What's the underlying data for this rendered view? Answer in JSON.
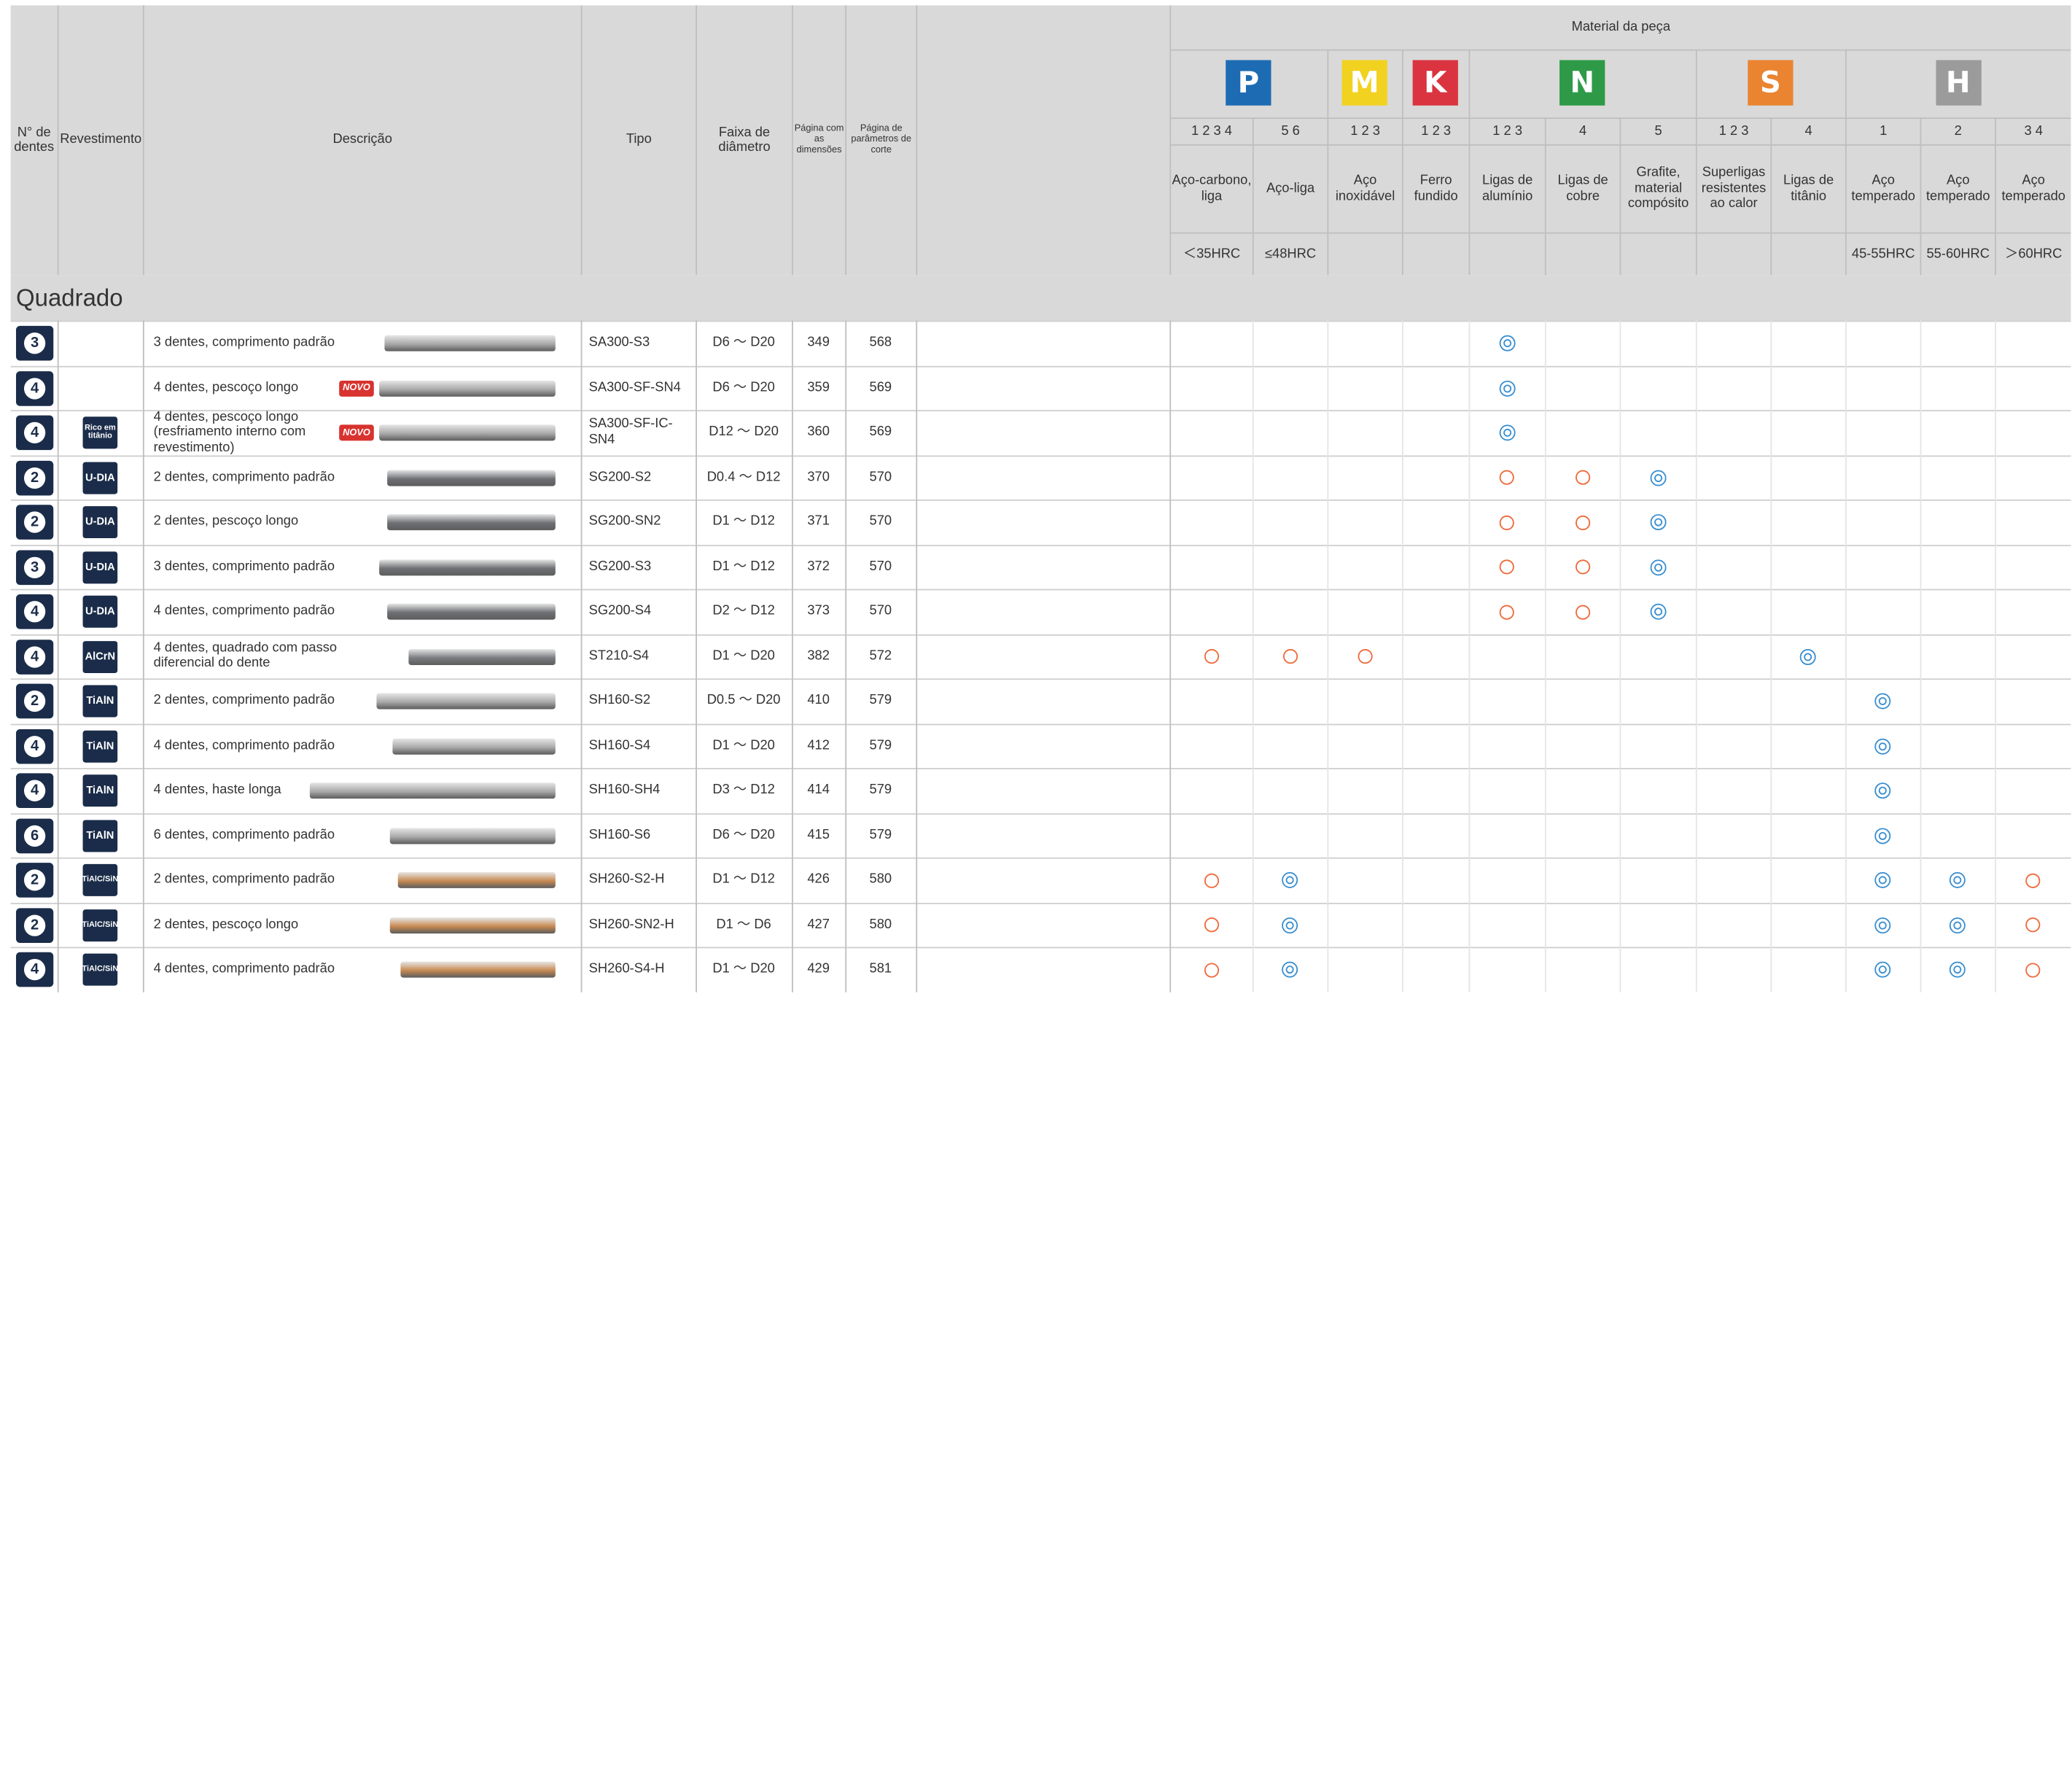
{
  "header": {
    "teeth": "N° de dentes",
    "coating": "Revestimento",
    "description": "Descrição",
    "type": "Tipo",
    "diameter": "Faixa de diâmetro",
    "dim_page": "Página com as dimensões",
    "cut_page": "Página de parâmetros de corte",
    "material_title": "Material da peça"
  },
  "groups": [
    {
      "letter": "P",
      "color": "#1d6bb3"
    },
    {
      "letter": "M",
      "color": "#f2d221"
    },
    {
      "letter": "K",
      "color": "#d9343f"
    },
    {
      "letter": "N",
      "color": "#2e9a48"
    },
    {
      "letter": "S",
      "color": "#ea8431"
    },
    {
      "letter": "H",
      "color": "#9b9b9b"
    }
  ],
  "materials": [
    {
      "num": "1 2 3 4",
      "name": "Aço-carbono, liga",
      "hard": "＜35HRC"
    },
    {
      "num": "5 6",
      "name": "Aço-liga",
      "hard": "≤48HRC"
    },
    {
      "num": "1 2 3",
      "name": "Aço inoxidável",
      "hard": ""
    },
    {
      "num": "1 2 3",
      "name": "Ferro fundido",
      "hard": ""
    },
    {
      "num": "1 2 3",
      "name": "Ligas de alumínio",
      "hard": ""
    },
    {
      "num": "4",
      "name": "Ligas de cobre",
      "hard": ""
    },
    {
      "num": "5",
      "name": "Grafite, material compósito",
      "hard": ""
    },
    {
      "num": "1 2 3",
      "name": "Superligas resistentes ao calor",
      "hard": ""
    },
    {
      "num": "4",
      "name": "Ligas de titânio",
      "hard": ""
    },
    {
      "num": "1",
      "name": "Aço temperado",
      "hard": "45-55HRC"
    },
    {
      "num": "2",
      "name": "Aço temperado",
      "hard": "55-60HRC"
    },
    {
      "num": "3 4",
      "name": "Aço temperado",
      "hard": "＞60HRC"
    }
  ],
  "section_title": "Quadrado",
  "badge_new": "NOVO",
  "rows": [
    {
      "teeth": "3",
      "coating": "",
      "desc": "3 dentes, comprimento padrão",
      "novo": false,
      "type": "SA300-S3",
      "dia": "D6 ～ D20",
      "dim": "349",
      "cut": "568",
      "marks": [
        "",
        "",
        "",
        "",
        "double",
        "",
        "",
        "",
        "",
        "",
        "",
        ""
      ]
    },
    {
      "teeth": "4",
      "coating": "",
      "desc": "4 dentes, pescoço longo",
      "novo": true,
      "type": "SA300-SF-SN4",
      "dia": "D6 ～ D20",
      "dim": "359",
      "cut": "569",
      "marks": [
        "",
        "",
        "",
        "",
        "double",
        "",
        "",
        "",
        "",
        "",
        "",
        ""
      ]
    },
    {
      "teeth": "4",
      "coating": "Rico em titânio",
      "desc": "4 dentes, pescoço longo (resfriamento interno com revestimento)",
      "novo": true,
      "type": "SA300-SF-IC-SN4",
      "dia": "D12 ～ D20",
      "dim": "360",
      "cut": "569",
      "marks": [
        "",
        "",
        "",
        "",
        "double",
        "",
        "",
        "",
        "",
        "",
        "",
        ""
      ]
    },
    {
      "teeth": "2",
      "coating": "U-DIA",
      "desc": "2 dentes, comprimento padrão",
      "novo": false,
      "type": "SG200-S2",
      "dia": "D0.4 ～ D12",
      "dim": "370",
      "cut": "570",
      "marks": [
        "",
        "",
        "",
        "",
        "single",
        "single",
        "double",
        "",
        "",
        "",
        "",
        ""
      ]
    },
    {
      "teeth": "2",
      "coating": "U-DIA",
      "desc": "2 dentes, pescoço longo",
      "novo": false,
      "type": "SG200-SN2",
      "dia": "D1 ～ D12",
      "dim": "371",
      "cut": "570",
      "marks": [
        "",
        "",
        "",
        "",
        "single",
        "single",
        "double",
        "",
        "",
        "",
        "",
        ""
      ]
    },
    {
      "teeth": "3",
      "coating": "U-DIA",
      "desc": "3 dentes, comprimento padrão",
      "novo": false,
      "type": "SG200-S3",
      "dia": "D1 ～ D12",
      "dim": "372",
      "cut": "570",
      "marks": [
        "",
        "",
        "",
        "",
        "single",
        "single",
        "double",
        "",
        "",
        "",
        "",
        ""
      ]
    },
    {
      "teeth": "4",
      "coating": "U-DIA",
      "desc": "4 dentes, comprimento padrão",
      "novo": false,
      "type": "SG200-S4",
      "dia": "D2 ～ D12",
      "dim": "373",
      "cut": "570",
      "marks": [
        "",
        "",
        "",
        "",
        "single",
        "single",
        "double",
        "",
        "",
        "",
        "",
        ""
      ]
    },
    {
      "teeth": "4",
      "coating": "AlCrN",
      "desc": "4 dentes, quadrado com passo diferencial do dente",
      "novo": false,
      "type": "ST210-S4",
      "dia": "D1 ～ D20",
      "dim": "382",
      "cut": "572",
      "marks": [
        "single",
        "single",
        "single",
        "",
        "",
        "",
        "",
        "",
        "double",
        "",
        "",
        ""
      ]
    },
    {
      "teeth": "2",
      "coating": "TiAlN",
      "desc": "2 dentes, comprimento padrão",
      "novo": false,
      "type": "SH160-S2",
      "dia": "D0.5 ～ D20",
      "dim": "410",
      "cut": "579",
      "marks": [
        "",
        "",
        "",
        "",
        "",
        "",
        "",
        "",
        "",
        "double",
        "",
        ""
      ]
    },
    {
      "teeth": "4",
      "coating": "TiAlN",
      "desc": "4 dentes, comprimento padrão",
      "novo": false,
      "type": "SH160-S4",
      "dia": "D1 ～ D20",
      "dim": "412",
      "cut": "579",
      "marks": [
        "",
        "",
        "",
        "",
        "",
        "",
        "",
        "",
        "",
        "double",
        "",
        ""
      ]
    },
    {
      "teeth": "4",
      "coating": "TiAlN",
      "desc": "4 dentes, haste longa",
      "novo": false,
      "type": "SH160-SH4",
      "dia": "D3 ～ D12",
      "dim": "414",
      "cut": "579",
      "marks": [
        "",
        "",
        "",
        "",
        "",
        "",
        "",
        "",
        "",
        "double",
        "",
        ""
      ]
    },
    {
      "teeth": "6",
      "coating": "TiAlN",
      "desc": "6 dentes, comprimento padrão",
      "novo": false,
      "type": "SH160-S6",
      "dia": "D6 ～ D20",
      "dim": "415",
      "cut": "579",
      "marks": [
        "",
        "",
        "",
        "",
        "",
        "",
        "",
        "",
        "",
        "double",
        "",
        ""
      ]
    },
    {
      "teeth": "2",
      "coating": "TiAlC/SiN",
      "desc": "2 dentes, comprimento padrão",
      "novo": false,
      "type": "SH260-S2-H",
      "dia": "D1 ～ D12",
      "dim": "426",
      "cut": "580",
      "marks": [
        "single",
        "double",
        "",
        "",
        "",
        "",
        "",
        "",
        "",
        "double",
        "double",
        "single"
      ]
    },
    {
      "teeth": "2",
      "coating": "TiAlC/SiN",
      "desc": "2 dentes, pescoço longo",
      "novo": false,
      "type": "SH260-SN2-H",
      "dia": "D1 ～ D6",
      "dim": "427",
      "cut": "580",
      "marks": [
        "single",
        "double",
        "",
        "",
        "",
        "",
        "",
        "",
        "",
        "double",
        "double",
        "single"
      ]
    },
    {
      "teeth": "4",
      "coating": "TiAlC/SiN",
      "desc": "4 dentes, comprimento padrão",
      "novo": false,
      "type": "SH260-S4-H",
      "dia": "D1 ～ D20",
      "dim": "429",
      "cut": "581",
      "marks": [
        "single",
        "double",
        "",
        "",
        "",
        "",
        "",
        "",
        "",
        "double",
        "double",
        "single"
      ]
    }
  ]
}
